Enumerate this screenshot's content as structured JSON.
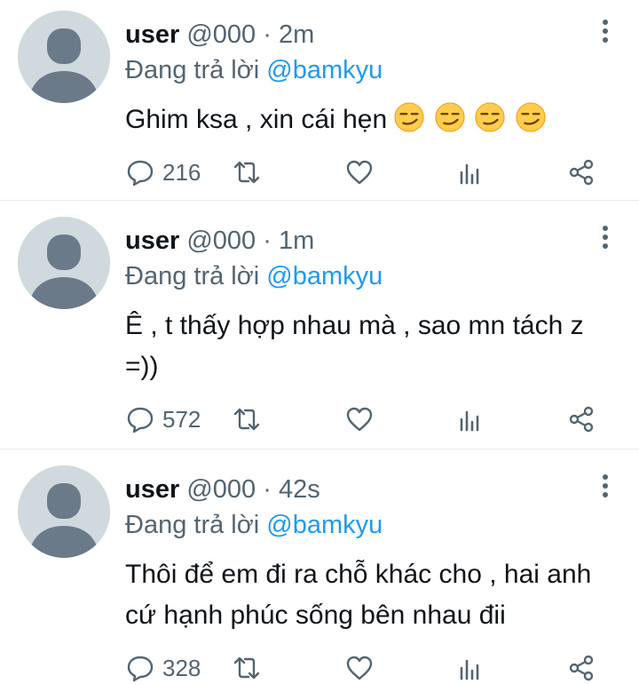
{
  "tweets": [
    {
      "name": "user",
      "handle": "@000",
      "separator": "·",
      "time": "2m",
      "reply_prefix": "Đang trả lời",
      "reply_to": "@bamkyu",
      "text": "Ghim ksa , xin cái hẹn",
      "emoji_count": 4,
      "replies": "216"
    },
    {
      "name": "user",
      "handle": "@000",
      "separator": "·",
      "time": "1m",
      "reply_prefix": "Đang trả lời",
      "reply_to": "@bamkyu",
      "text": "Ê , t thấy hợp nhau mà , sao mn tách z =))",
      "replies": "572"
    },
    {
      "name": "user",
      "handle": "@000",
      "separator": "·",
      "time": "42s",
      "reply_prefix": "Đang trả lời",
      "reply_to": "@bamkyu",
      "text": "Thôi để em đi ra chỗ khác cho , hai anh cứ hạnh phúc sống bên nhau đii",
      "replies": "328"
    }
  ],
  "icons": {
    "reply": "speech-bubble-icon",
    "retweet": "retweet-icon",
    "like": "heart-icon",
    "views": "bar-chart-icon",
    "share": "share-icon",
    "more": "vertical-dots-icon",
    "emoji": "smirking-face-emoji"
  },
  "colors": {
    "name": "#0f1419",
    "secondary": "#536471",
    "mention": "#1d9bf0",
    "avatar_bg": "#cfd9de",
    "avatar_fg": "#6b7a89",
    "divider": "#e6ecf0"
  }
}
